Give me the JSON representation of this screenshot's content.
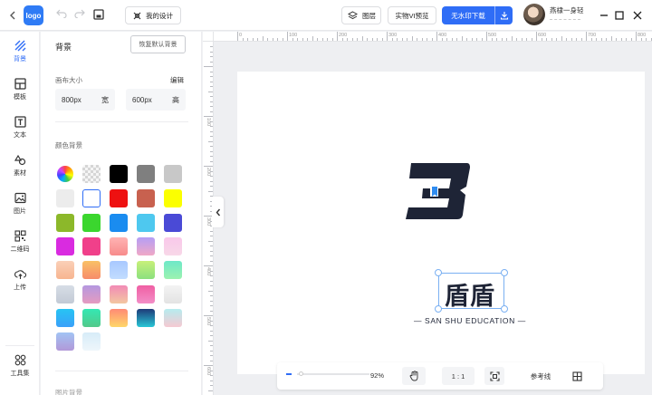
{
  "titlebar": {
    "my_design": "我的设计",
    "layer": "图层",
    "vi_preview": "实物VI预览",
    "download": "无水印下载",
    "username": "燕棣一身轻"
  },
  "nav": [
    {
      "label": "背景",
      "icon": "background-icon",
      "active": true
    },
    {
      "label": "模板",
      "icon": "template-icon"
    },
    {
      "label": "文本",
      "icon": "text-icon"
    },
    {
      "label": "素材",
      "icon": "elements-icon"
    },
    {
      "label": "图片",
      "icon": "image-icon"
    },
    {
      "label": "二维码",
      "icon": "qrcode-icon"
    },
    {
      "label": "上传",
      "icon": "upload-icon"
    },
    {
      "label": "工具集",
      "icon": "toolbox-icon"
    }
  ],
  "panel": {
    "title": "背景",
    "reset_button": "恢复默认背景",
    "canvas_size_label": "画布大小",
    "edit_label": "编辑",
    "width_value": "800px",
    "width_unit": "宽",
    "height_value": "600px",
    "height_unit": "高",
    "color_bg_label": "颜色背景",
    "next_section_label": "图片背景"
  },
  "swatches": [
    [
      "conic-gradient(#f44,#fa0,#ff0,#4c4,#0af,#44f,#c4f,#f44)",
      "checker",
      "#000000",
      "#7f7f7f",
      "#c8c8c8"
    ],
    [
      "#ececec",
      "#ffffff",
      "#ee1111",
      "#c8614f",
      "#fbff00"
    ],
    [
      "#8cb82a",
      "#3bd62e",
      "#1a8cf0",
      "#4ec8ef",
      "#4a4ad6"
    ],
    [
      "#d92be0",
      "#f0408a",
      "linear-gradient(#ffb3b3,#f78b8b)",
      "linear-gradient(#b59ef5,#f0a8c6)",
      "linear-gradient(#f9c8ea,#f8d8e8)"
    ],
    [
      "linear-gradient(#fad0b8,#f7b590)",
      "linear-gradient(#f9c166,#f78c6b)",
      "linear-gradient(#a8c8ff,#c2dcff)",
      "linear-gradient(#c8f07a,#8be07e)",
      "linear-gradient(#6ee8c8,#9cf2b0)"
    ],
    [
      "linear-gradient(#d7dde6,#c2cad5)",
      "linear-gradient(#b598e0,#e59bc0)",
      "linear-gradient(#f28bb6,#f3c7a1)",
      "linear-gradient(#f05fa3,#f38ec7)",
      "linear-gradient(#f3f3f3,#e3e3e3)"
    ],
    [
      "linear-gradient(#27c4f3,#3aa0f9)",
      "linear-gradient(#34e8b3,#52c98a)",
      "linear-gradient(#ff8a75,#ffd76a)",
      "linear-gradient(#1e3a78,#28c7d6)",
      "linear-gradient(#b6ecef,#f6c9d2)"
    ],
    [
      "linear-gradient(#a2c4f4,#b198d8)",
      "linear-gradient(#d7ecf8,#eef6fb)"
    ]
  ],
  "ruler": {
    "top": [
      "0",
      "100",
      "200",
      "300",
      "400",
      "500",
      "600",
      "700",
      "800"
    ],
    "left": [
      "100",
      "200",
      "300",
      "400",
      "500",
      "600"
    ]
  },
  "artboard": {
    "brand_cn": "盾盾",
    "brand_en": "— SAN SHU EDUCATION —"
  },
  "bottombar": {
    "zoom_pct": "92%",
    "ratio": "1 : 1",
    "guides": "参考线"
  },
  "colors": {
    "accent": "#2f6df6",
    "logo_dark": "#1e2436",
    "logo_blue": "#2f8cf0"
  }
}
